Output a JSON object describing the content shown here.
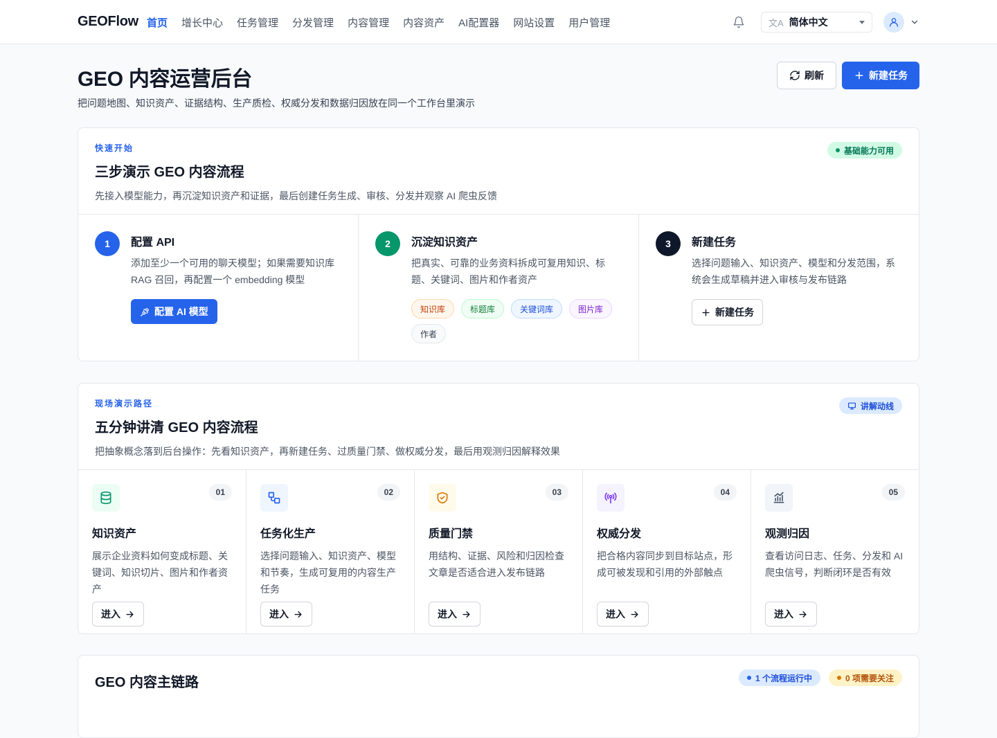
{
  "nav": {
    "brand": "GEOFlow",
    "items": [
      "首页",
      "增长中心",
      "任务管理",
      "分发管理",
      "内容管理",
      "内容资产",
      "AI配置器",
      "网站设置",
      "用户管理"
    ],
    "active_index": 0,
    "language": "简体中文",
    "icons": {
      "bell": "bell-icon",
      "lang": "translate-icon",
      "user": "user-icon",
      "menu": "chevron-down-icon"
    }
  },
  "header": {
    "title": "GEO 内容运营后台",
    "subtitle": "把问题地图、知识资产、证据结构、生产质检、权威分发和数据归因放在同一个工作台里演示",
    "refresh_label": "刷新",
    "new_task_label": "新建任务"
  },
  "quickstart": {
    "eyebrow": "快速开始",
    "title": "三步演示 GEO 内容流程",
    "desc": "先接入模型能力，再沉淀知识资产和证据，最后创建任务生成、审核、分发并观察 AI 爬虫反馈",
    "status": "基础能力可用",
    "steps": [
      {
        "num": "1",
        "title": "配置 API",
        "desc": "添加至少一个可用的聊天模型；如果需要知识库 RAG 召回，再配置一个 embedding 模型",
        "action": "配置 AI 模型",
        "color": "#2563eb"
      },
      {
        "num": "2",
        "title": "沉淀知识资产",
        "desc": "把真实、可靠的业务资料拆成可复用知识、标题、关键词、图片和作者资产",
        "tags": [
          "知识库",
          "标题库",
          "关键词库",
          "图片库",
          "作者"
        ],
        "color": "#059669"
      },
      {
        "num": "3",
        "title": "新建任务",
        "desc": "选择问题输入、知识资产、模型和分发范围，系统会生成草稿并进入审核与发布链路",
        "action": "新建任务",
        "color": "#0f172a"
      }
    ]
  },
  "demo": {
    "eyebrow": "现场演示路径",
    "title": "五分钟讲清 GEO 内容流程",
    "desc": "把抽象概念落到后台操作：先看知识资产，再新建任务、过质量门禁、做权威分发，最后用观测归因解释效果",
    "badge": "讲解动线",
    "cards": [
      {
        "num": "01",
        "title": "知识资产",
        "desc": "展示企业资料如何变成标题、关键词、知识切片、图片和作者资产",
        "icon": "database-icon",
        "bg": "#ecfdf5",
        "fg": "#059669"
      },
      {
        "num": "02",
        "title": "任务化生产",
        "desc": "选择问题输入、知识资产、模型和节奏，生成可复用的内容生产任务",
        "icon": "workflow-icon",
        "bg": "#eff6ff",
        "fg": "#2563eb"
      },
      {
        "num": "03",
        "title": "质量门禁",
        "desc": "用结构、证据、风险和归因检查文章是否适合进入发布链路",
        "icon": "shield-check-icon",
        "bg": "#fffbeb",
        "fg": "#d97706"
      },
      {
        "num": "04",
        "title": "权威分发",
        "desc": "把合格内容同步到目标站点，形成可被发现和引用的外部触点",
        "icon": "broadcast-icon",
        "bg": "#f5f3ff",
        "fg": "#7c3aed"
      },
      {
        "num": "05",
        "title": "观测归因",
        "desc": "查看访问日志、任务、分发和 AI 爬虫信号，判断闭环是否有效",
        "icon": "analytics-icon",
        "bg": "#f1f5f9",
        "fg": "#475569"
      }
    ],
    "enter_label": "进入"
  },
  "mainchain": {
    "title": "GEO 内容主链路",
    "running": "1 个流程运行中",
    "attention": "0 项需要关注"
  }
}
